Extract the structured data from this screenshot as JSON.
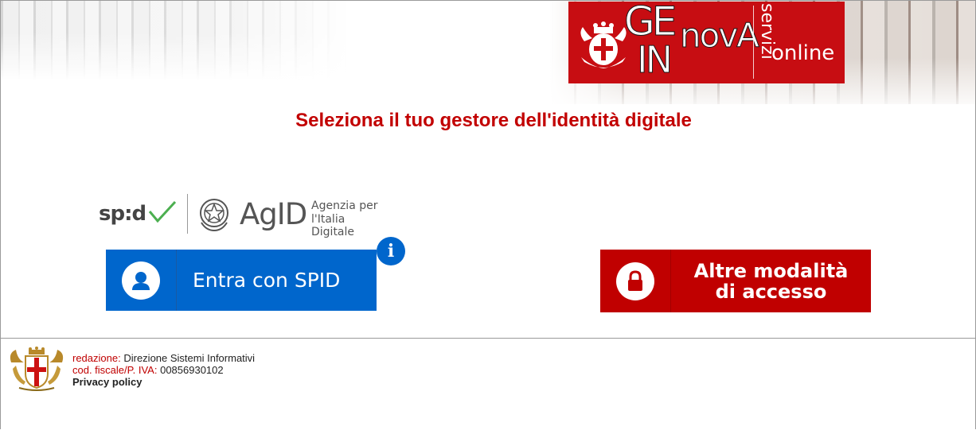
{
  "header": {
    "logo": {
      "ge": "GE",
      "in": "IN",
      "nova": "novA",
      "servizi": "servizi",
      "online": "online"
    }
  },
  "page": {
    "title": "Seleziona il tuo gestore dell'identità digitale"
  },
  "brands": {
    "spid": "sp:d",
    "agid": "AgID",
    "agid_sub_line1": "Agenzia per",
    "agid_sub_line2": "l'Italia Digitale"
  },
  "buttons": {
    "spid_label": "Entra con SPID",
    "info_glyph": "i",
    "alt_label_line1": "Altre modalità",
    "alt_label_line2": "di accesso"
  },
  "icons": {
    "spid_button": "user-icon",
    "alt_button": "lock-icon",
    "info": "info-icon"
  },
  "colors": {
    "title_red": "#c20000",
    "spid_blue": "#0066cc",
    "alt_red": "#c00000",
    "logo_red": "#c70d12"
  },
  "footer": {
    "redazione_label": "redazione:",
    "redazione_value": "Direzione Sistemi Informativi",
    "codfiscale_label": "cod. fiscale/P. IVA:",
    "codfiscale_value": "00856930102",
    "privacy": "Privacy policy"
  }
}
